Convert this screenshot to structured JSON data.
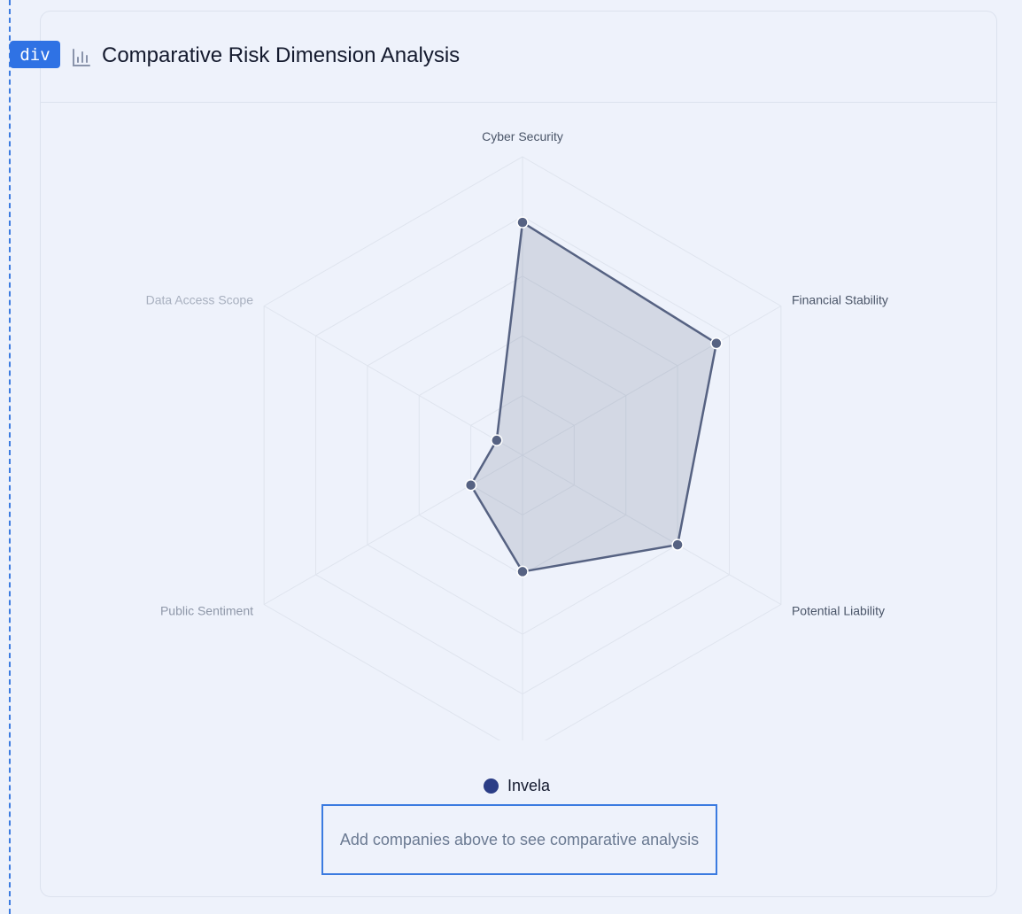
{
  "overlay": {
    "tag_label": "div"
  },
  "header": {
    "title": "Comparative Risk Dimension Analysis",
    "icon": "bar-chart-icon"
  },
  "legend": {
    "label": "Invela",
    "color": "#2b3d86"
  },
  "empty_state": {
    "message": "Add companies above to see comparative analysis"
  },
  "chart_data": {
    "type": "radar",
    "title": "",
    "axes": [
      "Cyber Security",
      "Financial Stability",
      "Potential Liability",
      "",
      "Public Sentiment",
      "Data Access Scope"
    ],
    "range": [
      0,
      100
    ],
    "rings": 5,
    "grid": true,
    "series": [
      {
        "name": "Invela",
        "values": [
          78,
          75,
          60,
          39,
          20,
          10
        ],
        "color": "#566282"
      }
    ]
  }
}
